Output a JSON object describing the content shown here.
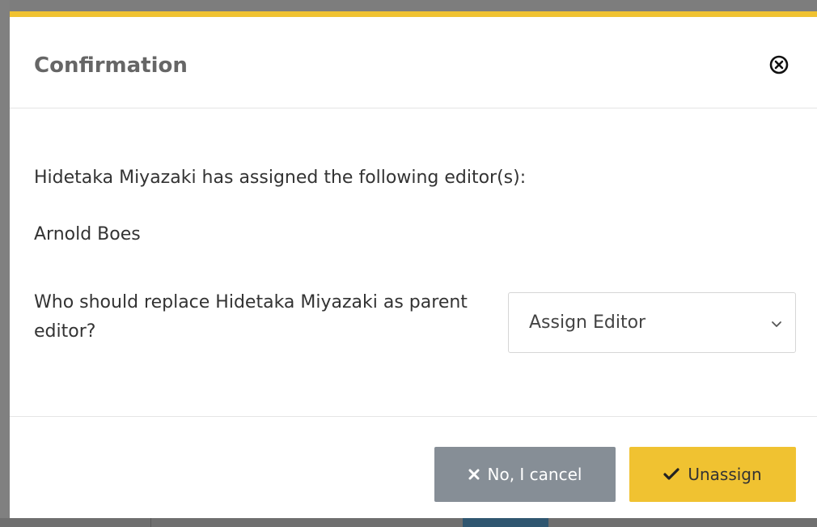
{
  "modal": {
    "title": "Confirmation",
    "message": "Hidetaka Miyazaki has assigned the following editor(s):",
    "editors": [
      "Arnold Boes"
    ],
    "question": "Who should replace Hidetaka Miyazaki as parent editor?",
    "select": {
      "selected": "Assign Editor",
      "icon": "chevron-down-icon"
    },
    "buttons": {
      "cancel_label": "No, I cancel",
      "cancel_icon": "x-icon",
      "confirm_label": "Unassign",
      "confirm_icon": "check-icon"
    },
    "close_icon": "close-circle-icon"
  },
  "colors": {
    "accent": "#f0c231",
    "cancel_button": "#868e96",
    "title_text": "#666666",
    "body_text": "#333333",
    "overlay": "#7d7d7d"
  }
}
